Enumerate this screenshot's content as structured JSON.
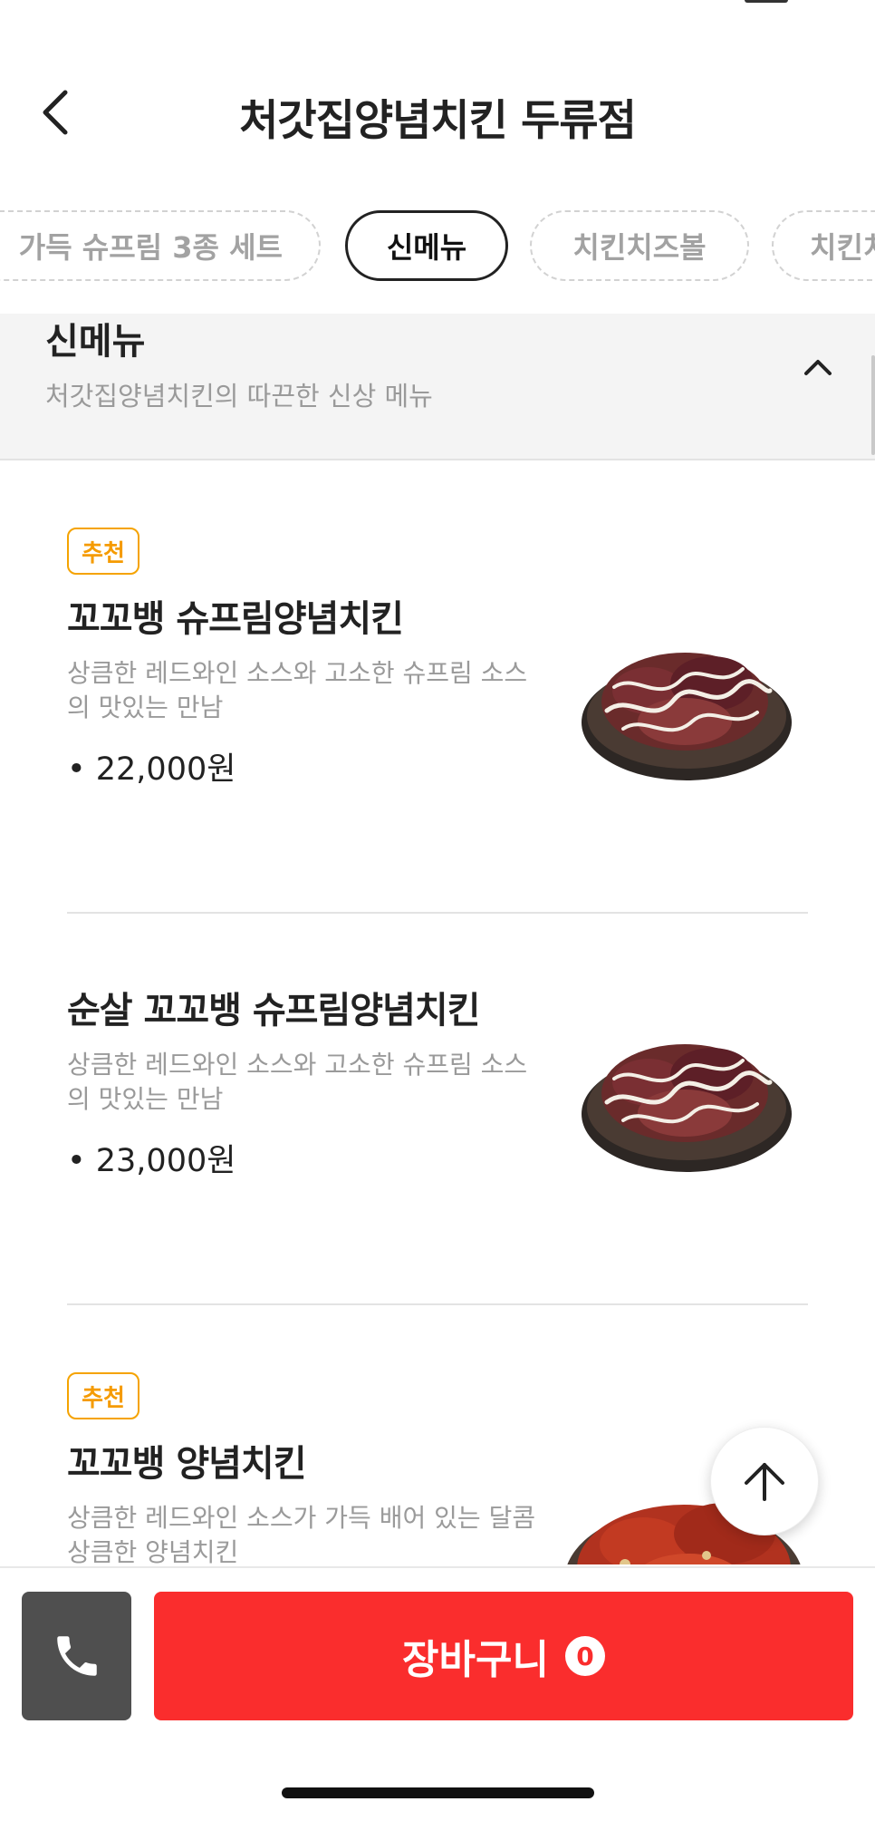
{
  "header": {
    "title": "처갓집양념치킨 두류점"
  },
  "tabs": [
    {
      "label": "가득 슈프림 3종 세트",
      "active": false
    },
    {
      "label": "신메뉴",
      "active": true
    },
    {
      "label": "치킨치즈볼",
      "active": false
    },
    {
      "label": "치킨치",
      "active": false
    }
  ],
  "section": {
    "title": "신메뉴",
    "description": "처갓집양념치킨의 따끈한 신상 메뉴"
  },
  "menu_items": [
    {
      "badge": "추천",
      "name": "꼬꼬뱅 슈프림양념치킨",
      "description": "상큼한 레드와인 소스와 고소한 슈프림 소스의 맛있는 만남",
      "price": "• 22,000원",
      "image": "chicken-supreme-image"
    },
    {
      "badge": "",
      "name": "순살 꼬꼬뱅 슈프림양념치킨",
      "description": "상큼한 레드와인 소스와 고소한 슈프림 소스의 맛있는 만남",
      "price": "• 23,000원",
      "image": "chicken-supreme-image"
    },
    {
      "badge": "추천",
      "name": "꼬꼬뱅 양념치킨",
      "description": "상큼한 레드와인 소스가 가득 배어 있는 달콤상큼한 양념치킨",
      "price": "",
      "image": "chicken-yangnyeom-image"
    }
  ],
  "bottom_bar": {
    "call_icon": "phone-icon",
    "cart_label": "장바구니",
    "cart_count": "0"
  },
  "icons": {
    "back": "chevron-left-icon",
    "collapse": "chevron-up-icon",
    "scroll_top": "arrow-up-icon"
  },
  "colors": {
    "accent_red": "#fa2d2d",
    "badge_orange": "#f59b00",
    "call_button": "#4f4f4f"
  }
}
